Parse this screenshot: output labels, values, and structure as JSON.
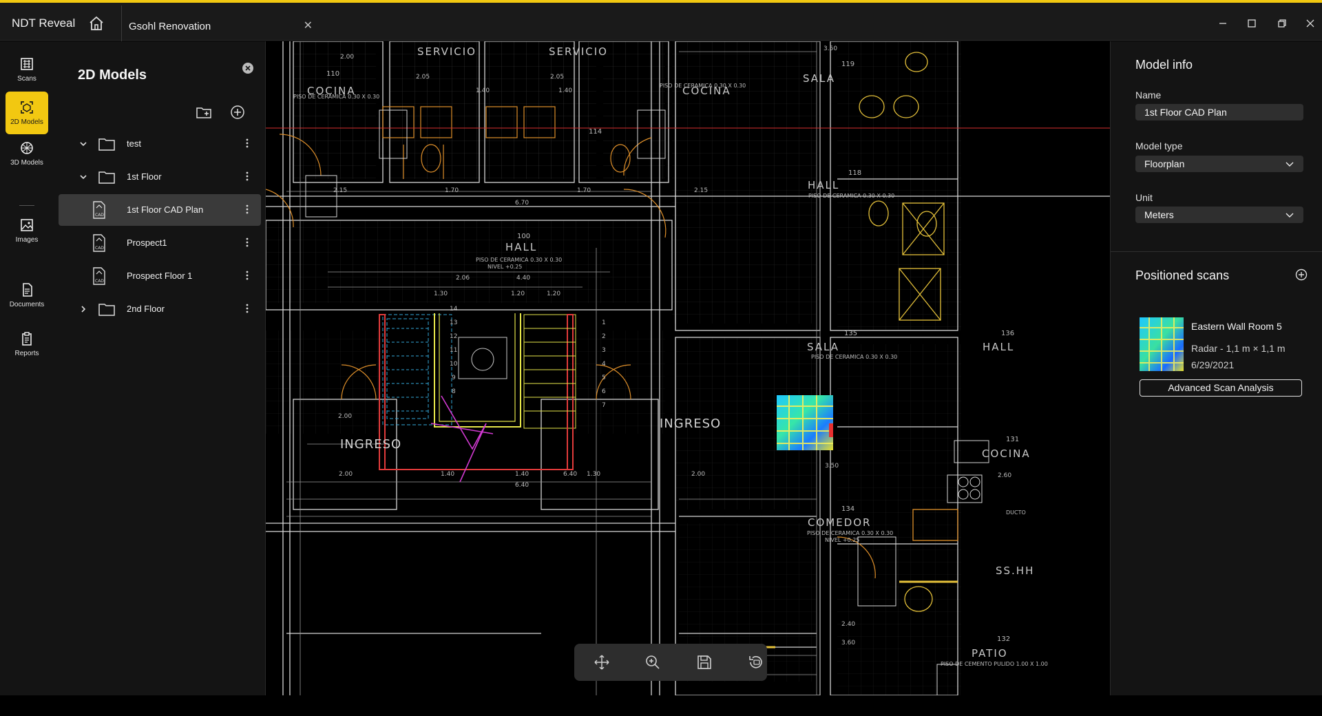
{
  "app": {
    "title": "NDT Reveal",
    "tab_label": "Gsohl Renovation",
    "accent": "#f2c811"
  },
  "rail": {
    "items": [
      {
        "label": "Scans",
        "icon": "scans-icon"
      },
      {
        "label": "2D Models",
        "icon": "2d-models-icon"
      },
      {
        "label": "3D Models",
        "icon": "3d-models-icon"
      },
      {
        "label": "Images",
        "icon": "images-icon"
      },
      {
        "label": "Documents",
        "icon": "documents-icon"
      },
      {
        "label": "Reports",
        "icon": "reports-icon"
      }
    ],
    "active": "2D Models"
  },
  "sidebar": {
    "title": "2D Models",
    "tree": [
      {
        "label": "test",
        "type": "folder",
        "expanded": true
      },
      {
        "label": "1st Floor",
        "type": "folder",
        "expanded": true
      },
      {
        "label": "1st Floor CAD Plan",
        "type": "cad",
        "badge": "CAD",
        "selected": true
      },
      {
        "label": "Prospect1",
        "type": "cad",
        "badge": "CAD"
      },
      {
        "label": "Prospect Floor 1",
        "type": "cad",
        "badge": "CAD"
      },
      {
        "label": "2nd Floor",
        "type": "folder",
        "expanded": false
      }
    ]
  },
  "drawing": {
    "rooms": {
      "servicio_left": "SERVICIO",
      "servicio_right": "SERVICIO",
      "cocina_left": "COCINA",
      "cocina_right": "COCINA",
      "sala_top": "SALA",
      "hall_mid": "HALL",
      "hall_center": "HALL",
      "sala_mid": "SALA",
      "hall_right": "HALL",
      "comedor": "COMEDOR",
      "cocina_lower": "COCINA",
      "patio": "PATIO",
      "ingreso_left": "INGRESO",
      "ingreso_right": "INGRESO",
      "ss_hh": "SS.HH",
      "ducto": "DUCTO"
    },
    "room_numbers": {
      "r110": "110",
      "r119": "119",
      "r118": "118",
      "r100": "100",
      "r135": "135",
      "r136": "136",
      "r131": "131",
      "r134": "134",
      "r132": "132",
      "r114": "114"
    },
    "floor_notes": {
      "ceramic": "PISO DE CERAMICA 0.30 X 0.30",
      "level": "NIVEL +0.25",
      "cement": "PISO DE CEMENTO PULIDO 1.00 X 1.00"
    },
    "dimensions": {
      "d1": "2.00",
      "d2": "2.05",
      "d3": "2.05",
      "d4": "3.50",
      "d5": "1.40",
      "d6": "1.40",
      "d7": "2.15",
      "d8": "1.70",
      "d9": "1.70",
      "d10": "2.15",
      "d11": "6.70",
      "d12": "2.06",
      "d13": "4.40",
      "d14": "1.30",
      "d15": "1.20",
      "d16": "1.20",
      "d17": "2.00",
      "d18": "3.50",
      "d19": "2.00",
      "d20": "1.40",
      "d21": "6.40",
      "d22": "2.00",
      "d23": "1.40",
      "d24": "2.40",
      "d25": "3.60",
      "d26": "2.60",
      "d27": "1.30",
      "d28": "6.40"
    },
    "stair_steps_left": [
      "14",
      "13",
      "12",
      "11",
      "10",
      "9",
      "8"
    ],
    "stair_steps_right": [
      "1",
      "2",
      "3",
      "4",
      "5",
      "6",
      "7"
    ]
  },
  "toolbar": {
    "tools": [
      "move-icon",
      "zoom-in-icon",
      "save-icon",
      "reset-view-icon"
    ]
  },
  "model_info": {
    "title": "Model info",
    "name_label": "Name",
    "name_value": "1st Floor CAD Plan",
    "type_label": "Model type",
    "type_value": "Floorplan",
    "unit_label": "Unit",
    "unit_value": "Meters"
  },
  "positioned_scans": {
    "title": "Positioned scans",
    "items": [
      {
        "name": "Eastern Wall Room 5",
        "detail": "Radar - 1,1 m × 1,1 m",
        "date": "6/29/2021",
        "action": "Advanced Scan Analysis"
      }
    ]
  }
}
